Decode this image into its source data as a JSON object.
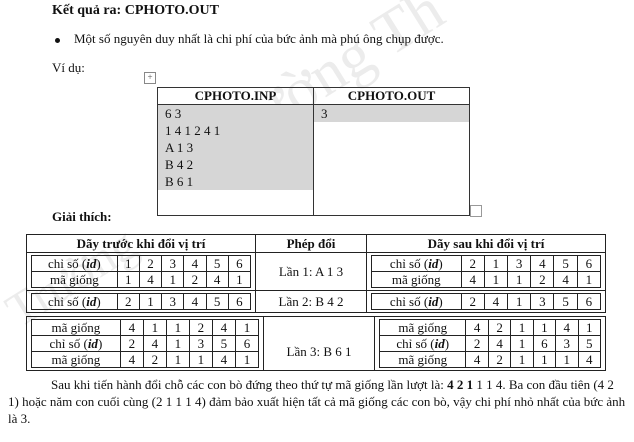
{
  "output_heading": "Kết quả ra: CPHOTO.OUT",
  "bullet_text": "Một số nguyên duy nhất là chi phí của bức ảnh mà phú ông chụp được.",
  "example_label": "Ví dụ:",
  "io_table": {
    "input_header": "CPHOTO.INP",
    "output_header": "CPHOTO.OUT",
    "input_lines": [
      "6 3",
      "1 4 1 2 4 1",
      "A 1 3",
      "B 4 2",
      "B 6 1"
    ],
    "output_lines": [
      "3"
    ]
  },
  "explain_label": "Giải thích:",
  "steps_table": {
    "headers": [
      "Dãy trước khi đổi vị trí",
      "Phép đổi",
      "Dãy sau khi đổi vị trí"
    ],
    "label_index": "chỉ số (id)",
    "label_index_pre": "chỉ số (",
    "label_index_em": "id",
    "label_index_post": ")",
    "label_gene": "mã giống",
    "step1": {
      "op": "Lần 1: A 1 3",
      "before_index": [
        "1",
        "2",
        "3",
        "4",
        "5",
        "6"
      ],
      "before_gene": [
        "1",
        "4",
        "1",
        "2",
        "4",
        "1"
      ],
      "after_index": [
        "2",
        "1",
        "3",
        "4",
        "5",
        "6"
      ],
      "after_gene": [
        "4",
        "1",
        "1",
        "2",
        "4",
        "1"
      ]
    },
    "step2": {
      "op": "Lần 2: B 4 2",
      "before_index": [
        "2",
        "1",
        "3",
        "4",
        "5",
        "6"
      ],
      "after_index": [
        "2",
        "4",
        "1",
        "3",
        "5",
        "6"
      ]
    },
    "step3": {
      "op": "Lần 3: B 6 1",
      "before_gene": [
        "4",
        "1",
        "1",
        "2",
        "4",
        "1"
      ],
      "before_index": [
        "2",
        "4",
        "1",
        "3",
        "5",
        "6"
      ],
      "before_gene2": [
        "4",
        "2",
        "1",
        "1",
        "4",
        "1"
      ],
      "after_gene": [
        "4",
        "2",
        "1",
        "1",
        "4",
        "1"
      ],
      "after_index": [
        "2",
        "4",
        "1",
        "6",
        "3",
        "5"
      ],
      "after_gene2": [
        "4",
        "2",
        "1",
        "1",
        "1",
        "4"
      ]
    }
  },
  "paragraph": {
    "p1": "Sau khi tiến hành đổi chỗ các con bò đứng theo thứ tự mã giống lần lượt là: ",
    "p1_bold": "4 2 1",
    "p2": " 1 1 4. Ba con đầu tiên (4 2 1) hoặc năm con cuối cùng (2 1 1 1 4) đảm bảo xuất hiện tất cả mã giống các con bò, vậy chi phí nhỏ nhất của bức ảnh là 3."
  }
}
